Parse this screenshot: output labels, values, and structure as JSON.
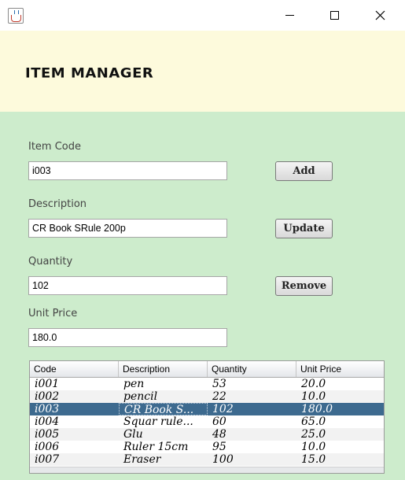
{
  "window": {
    "min_icon": "minimize-icon",
    "max_icon": "maximize-icon",
    "close_icon": "close-icon",
    "app_icon": "java-cup-icon"
  },
  "header": {
    "title": "ITEM MANAGER",
    "background": "#fdfadc"
  },
  "form": {
    "item_code_label": "Item Code",
    "item_code_value": "i003",
    "description_label": "Description",
    "description_value": "CR Book SRule 200p",
    "quantity_label": "Quantity",
    "quantity_value": "102",
    "unit_price_label": "Unit Price",
    "unit_price_value": "180.0",
    "background": "#cdeccc"
  },
  "buttons": {
    "add": "Add",
    "update": "Update",
    "remove": "Remove"
  },
  "table": {
    "columns": [
      "Code",
      "Description",
      "Quantity",
      "Unit Price"
    ],
    "selected_row": 2,
    "selection_color": "#3d6a8f",
    "rows": [
      [
        "i001",
        "pen",
        "53",
        "20.0"
      ],
      [
        "i002",
        "pencil",
        "22",
        "10.0"
      ],
      [
        "i003",
        "CR Book S...",
        "102",
        "180.0"
      ],
      [
        "i004",
        "Squar rule...",
        "60",
        "65.0"
      ],
      [
        "i005",
        "Glu",
        "48",
        "25.0"
      ],
      [
        "i006",
        "Ruler 15cm",
        "95",
        "10.0"
      ],
      [
        "i007",
        "Eraser",
        "100",
        "15.0"
      ]
    ]
  }
}
